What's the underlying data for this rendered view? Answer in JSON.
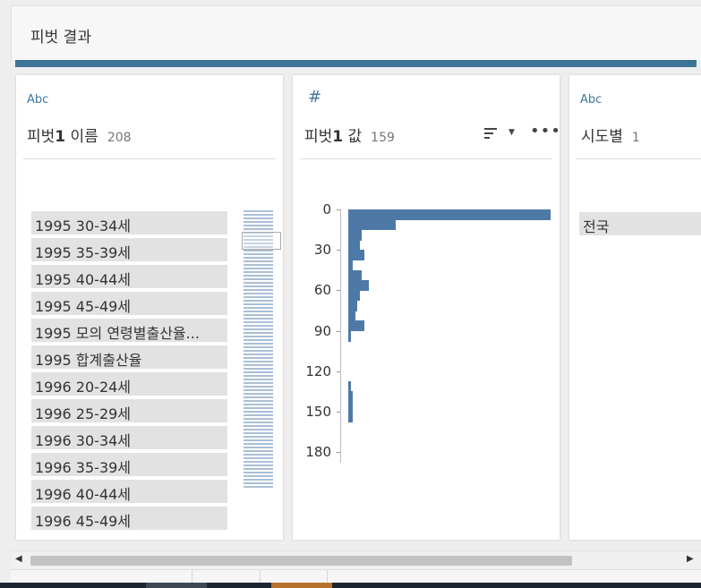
{
  "header": {
    "title": "피벗 결과"
  },
  "cards": [
    {
      "type_label": "Abc",
      "name_prefix": "피벗",
      "name_bold": "1",
      "name_suffix": " 이름",
      "count": "208"
    },
    {
      "type_label": "#",
      "name_prefix": "피벗",
      "name_bold": "1",
      "name_suffix": " 값",
      "count": "159"
    },
    {
      "type_label": "Abc",
      "name_prefix": "시도별",
      "name_bold": "",
      "name_suffix": "",
      "count": "1"
    }
  ],
  "card1_values": [
    "1995 30-34세",
    "1995 35-39세",
    "1995 40-44세",
    "1995 45-49세",
    "1995 모의 연령별출산율...",
    "1995 합계출산율",
    "1996 20-24세",
    "1996 25-29세",
    "1996 30-34세",
    "1996 35-39세",
    "1996 40-44세",
    "1996 45-49세"
  ],
  "card3_values": [
    "전국"
  ],
  "chart_data": {
    "type": "bar",
    "orientation": "horizontal",
    "ylabel_ticks": [
      "0",
      "30",
      "60",
      "90",
      "120",
      "150",
      "180"
    ],
    "bins_start": [
      0,
      7.5,
      15,
      22.5,
      30,
      37.5,
      45,
      52.5,
      60,
      67.5,
      75,
      82.5,
      90,
      97.5,
      105,
      112.5,
      120,
      127.5,
      135,
      142.5,
      150,
      157.5,
      165,
      172.5,
      180
    ],
    "values": [
      90,
      21,
      6,
      5,
      7,
      2,
      6,
      9,
      5,
      4,
      3,
      7,
      1,
      0,
      0,
      0,
      0,
      1,
      2,
      2,
      2,
      0,
      0,
      0,
      0
    ],
    "xlim": [
      0,
      90
    ],
    "ylim": [
      0,
      187.5
    ]
  },
  "scrollbar": {
    "left_arrow": "◀",
    "right_arrow": "▶"
  }
}
